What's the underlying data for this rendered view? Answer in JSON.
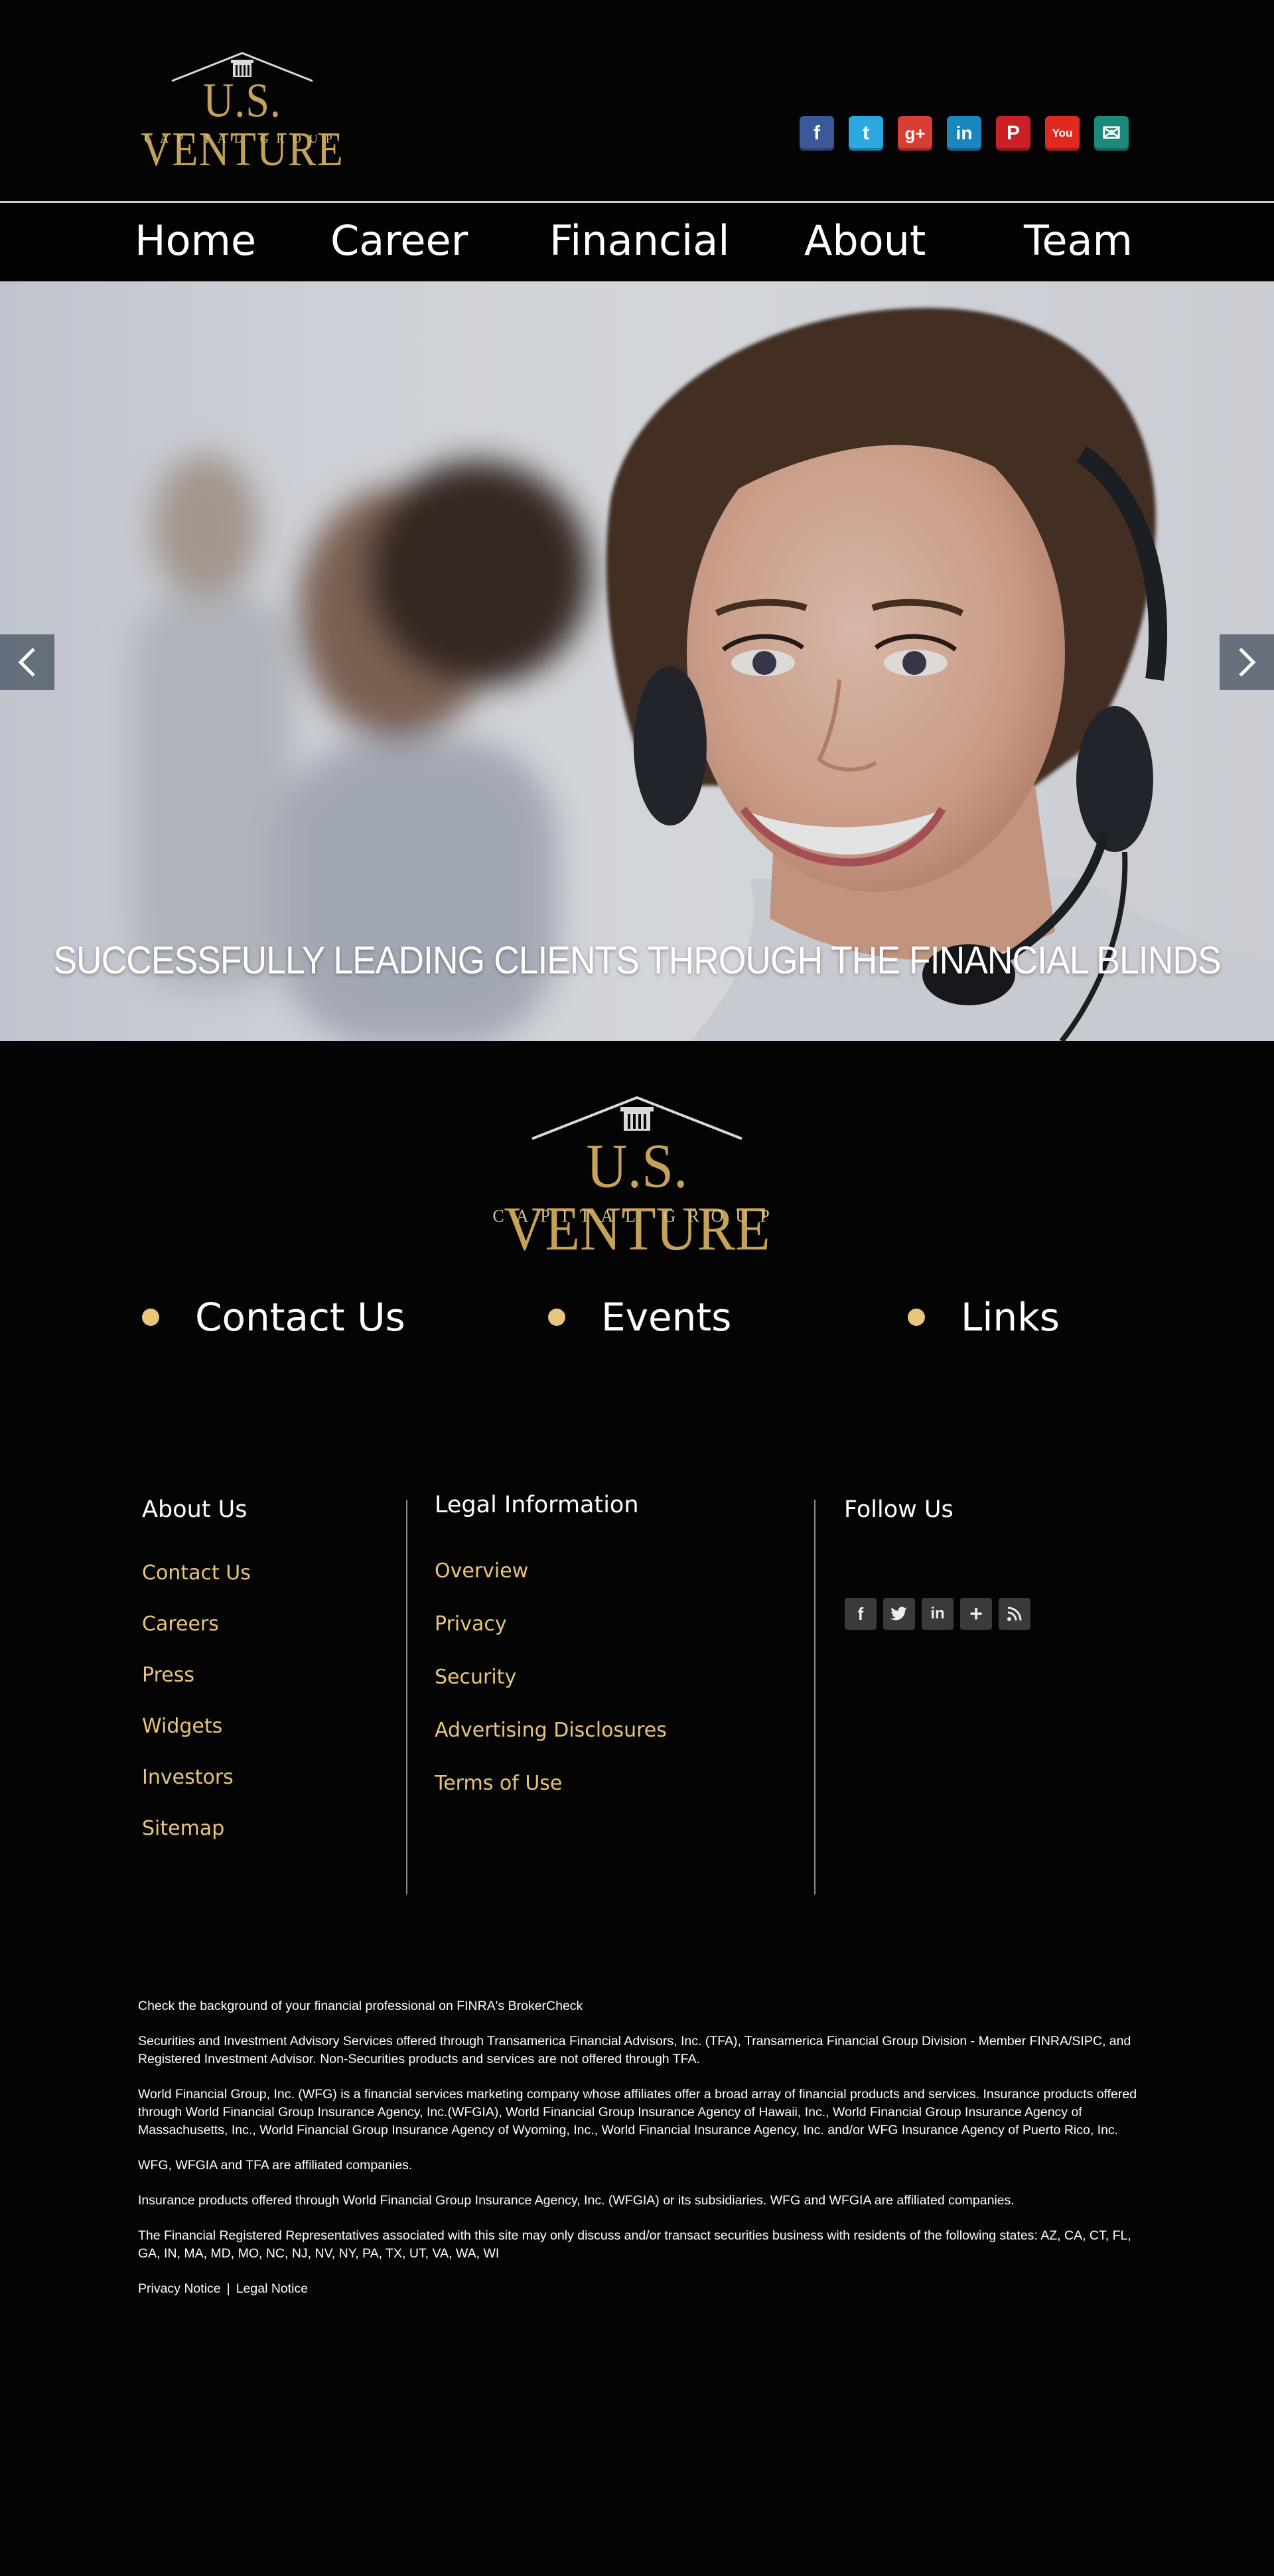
{
  "brand": {
    "name_main": "U.S. VENTURE",
    "name_sub": "CAPITAL GROUP",
    "gold": "#c5a258"
  },
  "social_icons": [
    {
      "name": "facebook-icon",
      "glyph": "f",
      "color": "#3b5998"
    },
    {
      "name": "twitter-icon",
      "glyph": "t",
      "color": "#2aa9e0"
    },
    {
      "name": "google-plus-icon",
      "glyph": "g+",
      "color": "#d73d32"
    },
    {
      "name": "linkedin-icon",
      "glyph": "in",
      "color": "#1b86bd"
    },
    {
      "name": "pinterest-icon",
      "glyph": "P",
      "color": "#cb2027"
    },
    {
      "name": "youtube-icon",
      "glyph": "You",
      "color": "#e02a20"
    },
    {
      "name": "email-icon",
      "glyph": "✉",
      "color": "#1c8a7a"
    }
  ],
  "nav": {
    "home": "Home",
    "career": "Career",
    "financial": "Financial",
    "about": "About",
    "team": "Team"
  },
  "hero": {
    "tagline": "SUCCESSFULLY LEADING CLIENTS THROUGH THE FINANCIAL BLINDS",
    "prev_icon": "chevron-left-icon",
    "next_icon": "chevron-right-icon"
  },
  "quick_links": {
    "contact": "Contact Us",
    "events": "Events",
    "links": "Links",
    "bullet_color": "#e8c57a"
  },
  "footer": {
    "about": {
      "heading": "About Us",
      "items": [
        "Contact Us",
        "Careers",
        "Press",
        "Widgets",
        "Investors",
        "Sitemap"
      ]
    },
    "legal": {
      "heading": "Legal Information",
      "items": [
        "Overview",
        "Privacy",
        "Security",
        "Advertising Disclosures",
        "Terms of Use"
      ]
    },
    "follow": {
      "heading": "Follow Us",
      "icons": [
        "facebook-icon",
        "twitter-icon",
        "linkedin-icon",
        "plus-icon",
        "rss-icon"
      ]
    }
  },
  "disclaimers": {
    "p1": "Check the background of your financial professional on FINRA's BrokerCheck",
    "p2": "Securities and Investment Advisory Services offered through Transamerica Financial Advisors, Inc. (TFA), Transamerica Financial Group Division - Member FINRA/SIPC, and Registered Investment Advisor. Non-Securities products and services are not offered through TFA.",
    "p3": "World Financial Group, Inc. (WFG) is a financial services marketing company whose affiliates offer a broad array of financial products and services. Insurance products offered through World Financial Group Insurance Agency, Inc.(WFGIA), World Financial Group Insurance Agency of Hawaii, Inc., World Financial Group Insurance Agency of Massachusetts, Inc., World Financial Group Insurance Agency of Wyoming, Inc., World Financial Insurance Agency, Inc. and/or WFG Insurance Agency of Puerto Rico, Inc.",
    "p4": "WFG, WFGIA and TFA are affiliated companies.",
    "p5": "Insurance products offered through World Financial Group Insurance Agency, Inc. (WFGIA) or its subsidiaries. WFG and WFGIA are affiliated companies.",
    "p6": "The Financial Registered Representatives associated with this site may only discuss and/or transact securities business with residents of the following states: AZ, CA, CT, FL, GA, IN, MA, MD, MO, NC, NJ, NV, NY, PA, TX, UT, VA, WA, WI",
    "privacy_notice": "Privacy Notice",
    "separator": "|",
    "legal_notice": "Legal Notice"
  }
}
